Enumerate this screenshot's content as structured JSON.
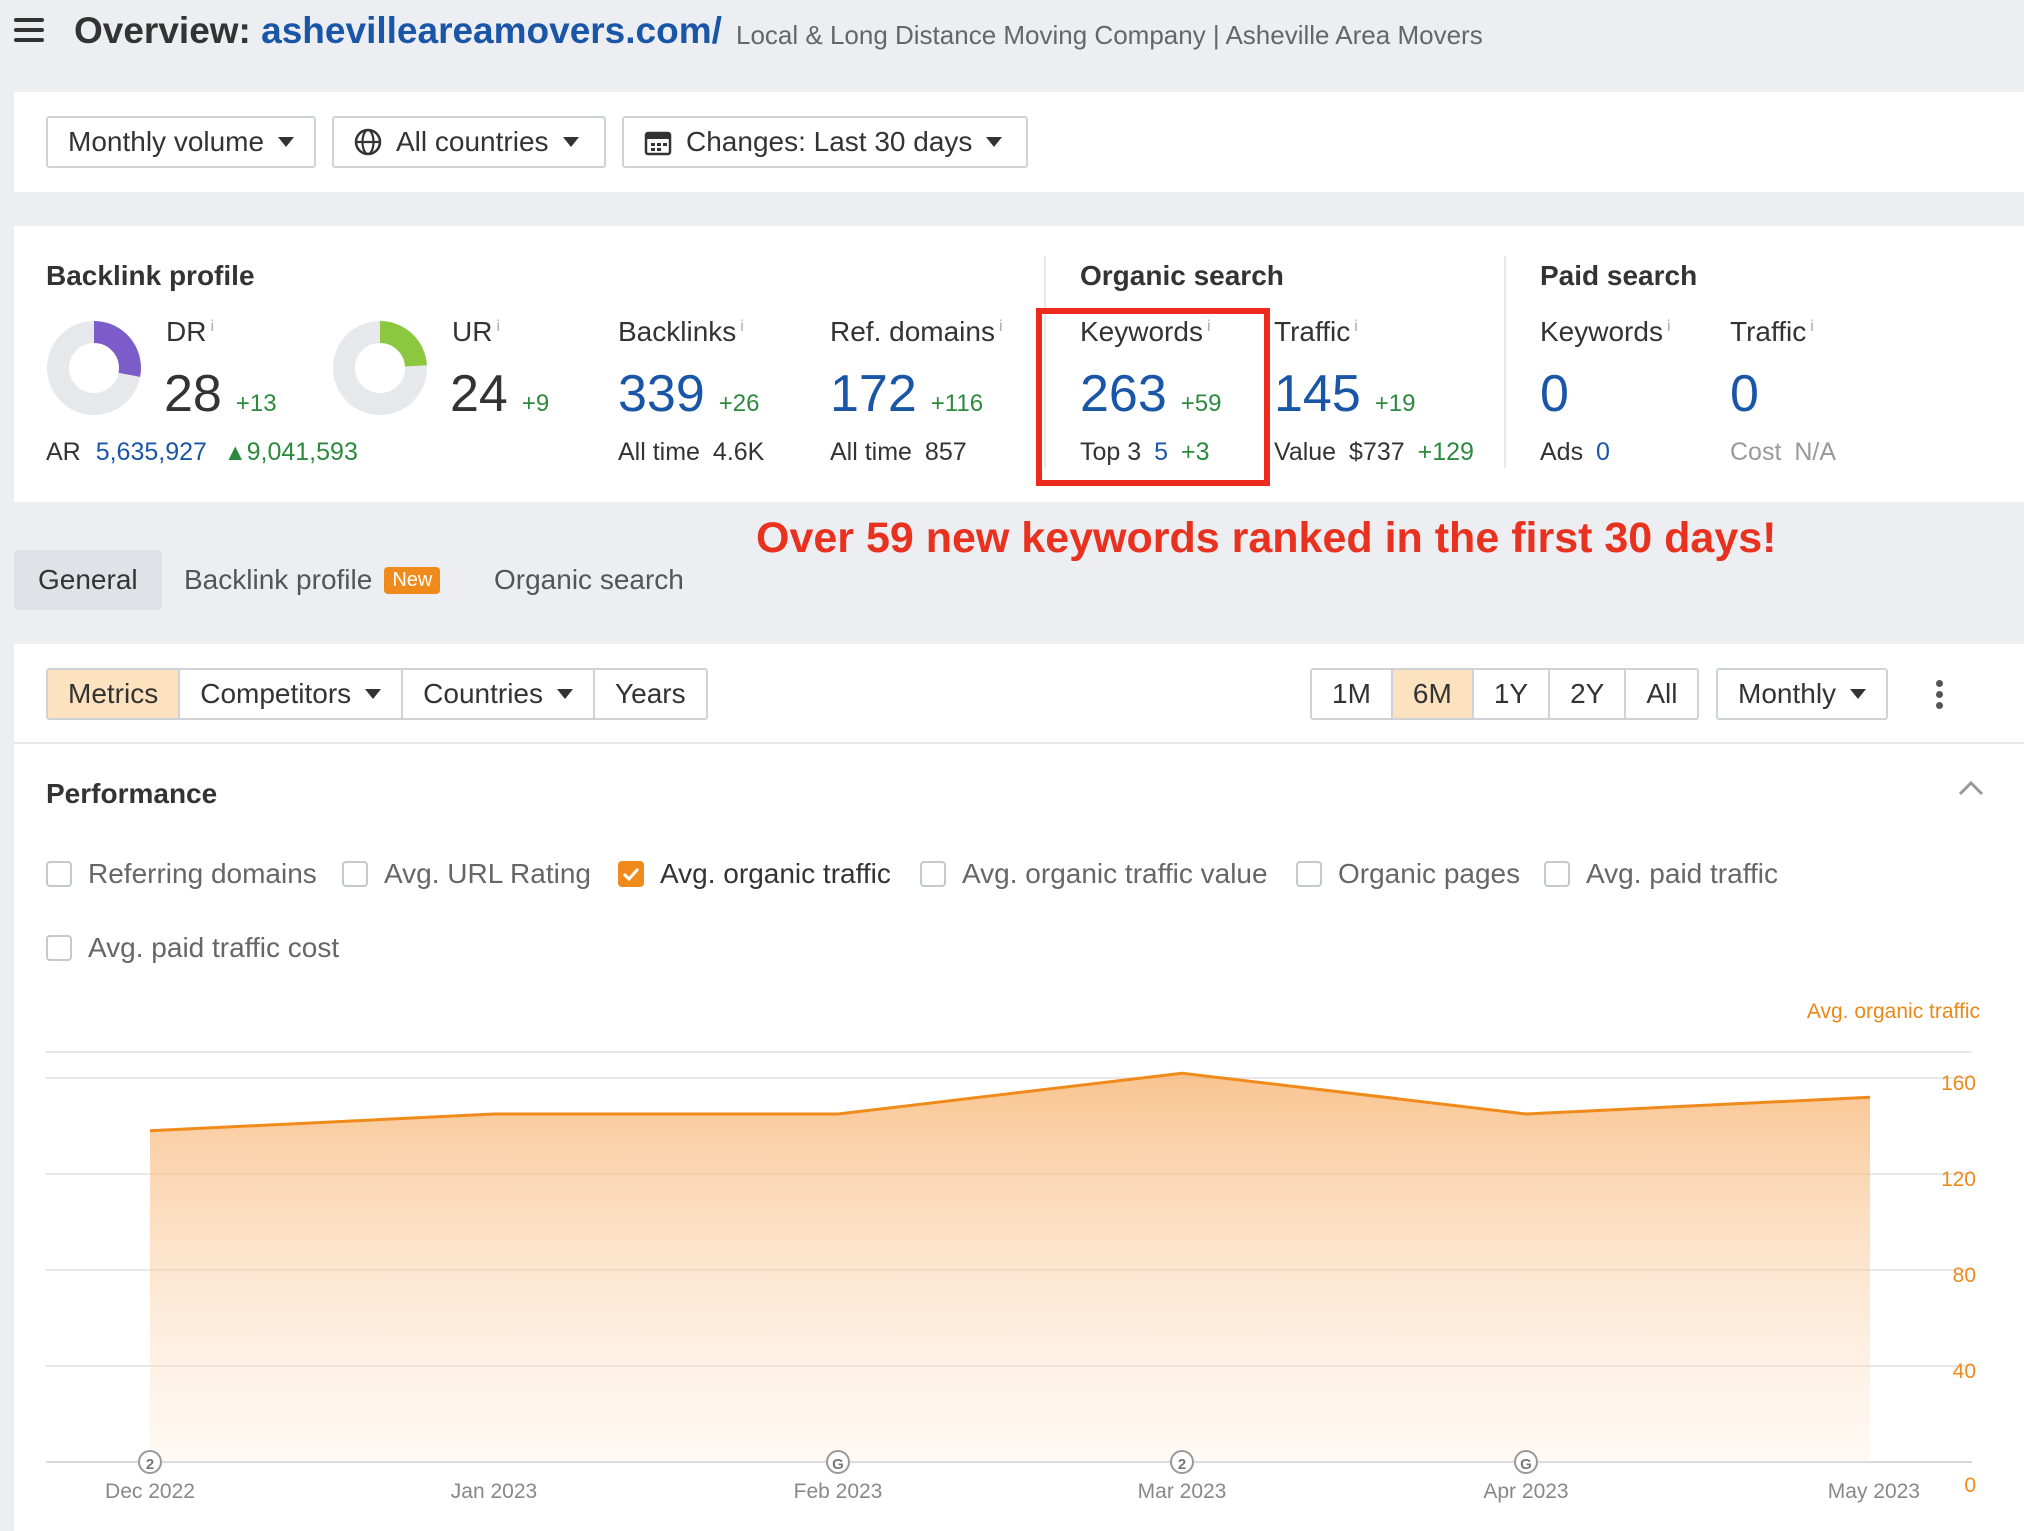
{
  "header": {
    "title_prefix": "Overview:",
    "domain": "ashevilleareamovers.com/",
    "site_title": "Local & Long Distance Moving Company | Asheville Area Movers"
  },
  "filters": {
    "volume": "Monthly volume",
    "countries": "All countries",
    "changes": "Changes: Last 30 days"
  },
  "backlink_profile": {
    "title": "Backlink profile",
    "dr": {
      "label": "DR",
      "value": "28",
      "delta": "+13",
      "fill": 0.28,
      "color": "#7b5cc9"
    },
    "ur": {
      "label": "UR",
      "value": "24",
      "delta": "+9",
      "fill": 0.24,
      "color": "#8dc63f"
    },
    "ar": {
      "label": "AR",
      "value": "5,635,927",
      "delta": "9,041,593"
    },
    "backlinks": {
      "label": "Backlinks",
      "value": "339",
      "delta": "+26",
      "sub_label": "All time",
      "sub_value": "4.6K"
    },
    "ref_domains": {
      "label": "Ref. domains",
      "value": "172",
      "delta": "+116",
      "sub_label": "All time",
      "sub_value": "857"
    }
  },
  "organic_search": {
    "title": "Organic search",
    "keywords": {
      "label": "Keywords",
      "value": "263",
      "delta": "+59",
      "sub_label": "Top 3",
      "sub_value": "5",
      "sub_delta": "+3"
    },
    "traffic": {
      "label": "Traffic",
      "value": "145",
      "delta": "+19",
      "sub_label": "Value",
      "sub_value": "$737",
      "sub_delta": "+129"
    }
  },
  "paid_search": {
    "title": "Paid search",
    "keywords": {
      "label": "Keywords",
      "value": "0",
      "sub_label": "Ads",
      "sub_value": "0"
    },
    "traffic": {
      "label": "Traffic",
      "value": "0",
      "sub_label": "Cost",
      "sub_value": "N/A"
    }
  },
  "info_mark": "i",
  "annotation": "Over 59 new keywords ranked in the first 30 days!",
  "tabs": {
    "general": "General",
    "backlink_profile": "Backlink profile",
    "new_badge": "New",
    "organic_search": "Organic search"
  },
  "toolbar": {
    "metrics": "Metrics",
    "competitors": "Competitors",
    "countries": "Countries",
    "years": "Years",
    "ranges": [
      "1M",
      "6M",
      "1Y",
      "2Y",
      "All"
    ],
    "active_range": "6M",
    "interval": "Monthly"
  },
  "performance": {
    "title": "Performance",
    "checkboxes": [
      {
        "label": "Referring domains",
        "checked": false
      },
      {
        "label": "Avg. URL Rating",
        "checked": false
      },
      {
        "label": "Avg. organic traffic",
        "checked": true
      },
      {
        "label": "Avg. organic traffic value",
        "checked": false
      },
      {
        "label": "Organic pages",
        "checked": false
      },
      {
        "label": "Avg. paid traffic",
        "checked": false
      },
      {
        "label": "Avg. paid traffic cost",
        "checked": false
      }
    ]
  },
  "chart_data": {
    "type": "area",
    "series": [
      {
        "name": "Avg. organic traffic",
        "values": [
          138,
          145,
          145,
          162,
          145,
          152
        ]
      }
    ],
    "x": [
      "Dec 2022",
      "Jan 2023",
      "Feb 2023",
      "Mar 2023",
      "Apr 2023",
      "May 2023"
    ],
    "x_positions": [
      0,
      1,
      2,
      3,
      4,
      5
    ],
    "ylabel": "Avg. organic traffic",
    "yticks": [
      0,
      40,
      80,
      120,
      160
    ],
    "ylim": [
      0,
      160
    ],
    "markers": [
      {
        "x": "Dec 2022",
        "label": "2"
      },
      {
        "x": "Feb 2023",
        "label": "G"
      },
      {
        "x": "Mar 2023",
        "label": "2"
      },
      {
        "x": "Apr 2023",
        "label": "G"
      }
    ],
    "color": "#f08a1a",
    "grid": true
  }
}
